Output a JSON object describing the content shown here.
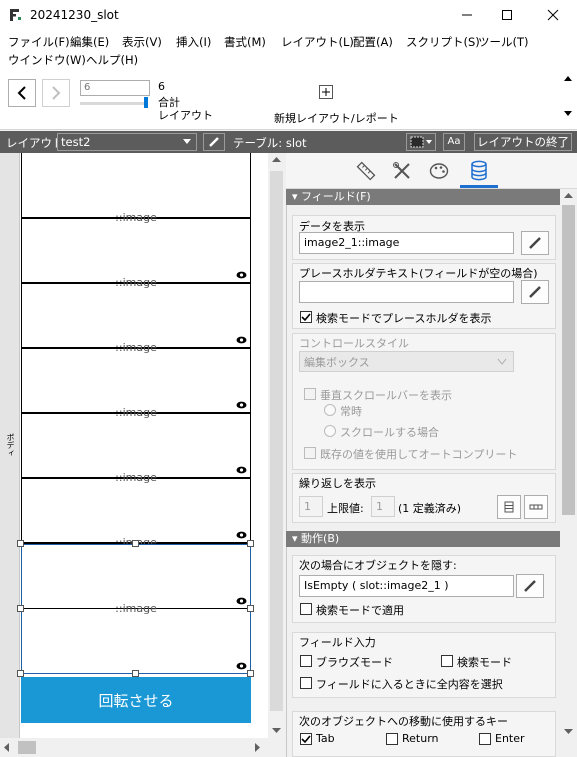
{
  "window": {
    "title": "20241230_slot"
  },
  "menu": [
    "ファイル(F)",
    "編集(E)",
    "表示(V)",
    "挿入(I)",
    "書式(M)",
    "レイアウト(L)",
    "配置(A)",
    "スクリプト(S)",
    "ツール(T)",
    "ウインドウ(W)",
    "ヘルプ(H)"
  ],
  "toolbar": {
    "record_value": "6",
    "count": "6",
    "count_label": "合計",
    "layout_label": "レイアウト",
    "new_layout_label": "新規レイアウト/レポート",
    "slider_fraction": 1.0
  },
  "layoutbar": {
    "layout_label": "レイアウト:",
    "layout_name": "test2",
    "table_label": "テーブル: slot",
    "aa_label": "Aa",
    "exit_label": "レイアウトの終了"
  },
  "canvas": {
    "body_label": "ボディ",
    "row_labels": [
      "::image",
      "::image",
      "::image",
      "::image",
      "::image",
      "::image",
      "::image"
    ],
    "button_label": "回転させる",
    "button_color": "#1a98d5"
  },
  "inspector": {
    "field_section": "フィールド(F)",
    "display_data_label": "データを表示",
    "display_data_value": "image2_1::image",
    "placeholder_label": "プレースホルダテキスト(フィールドが空の場合)",
    "placeholder_value": "",
    "placeholder_find_label": "検索モードでプレースホルダを表示",
    "control_style_label": "コントロールスタイル",
    "control_style_value": "編集ボックス",
    "vscroll_label": "垂直スクロールバーを表示",
    "always_label": "常時",
    "when_scrolling_label": "スクロールする場合",
    "autocomplete_label": "既存の値を使用してオートコンプリート",
    "repetitions_label": "繰り返しを表示",
    "rep_start": "1",
    "max_label": "上限値:",
    "rep_max": "1",
    "defined_label": "(1 定義済み)",
    "behavior_section": "動作(B)",
    "hide_label": "次の場合にオブジェクトを隠す:",
    "hide_value": "IsEmpty ( slot::image2_1 )",
    "apply_find_label": "検索モードで適用",
    "field_entry_label": "フィールド入力",
    "browse_label": "ブラウズモード",
    "find_label": "検索モード",
    "select_all_label": "フィールドに入るときに全内容を選択",
    "keys_label": "次のオブジェクトへの移動に使用するキー",
    "tab_label": "Tab",
    "return_label": "Return",
    "enter_label": "Enter"
  }
}
